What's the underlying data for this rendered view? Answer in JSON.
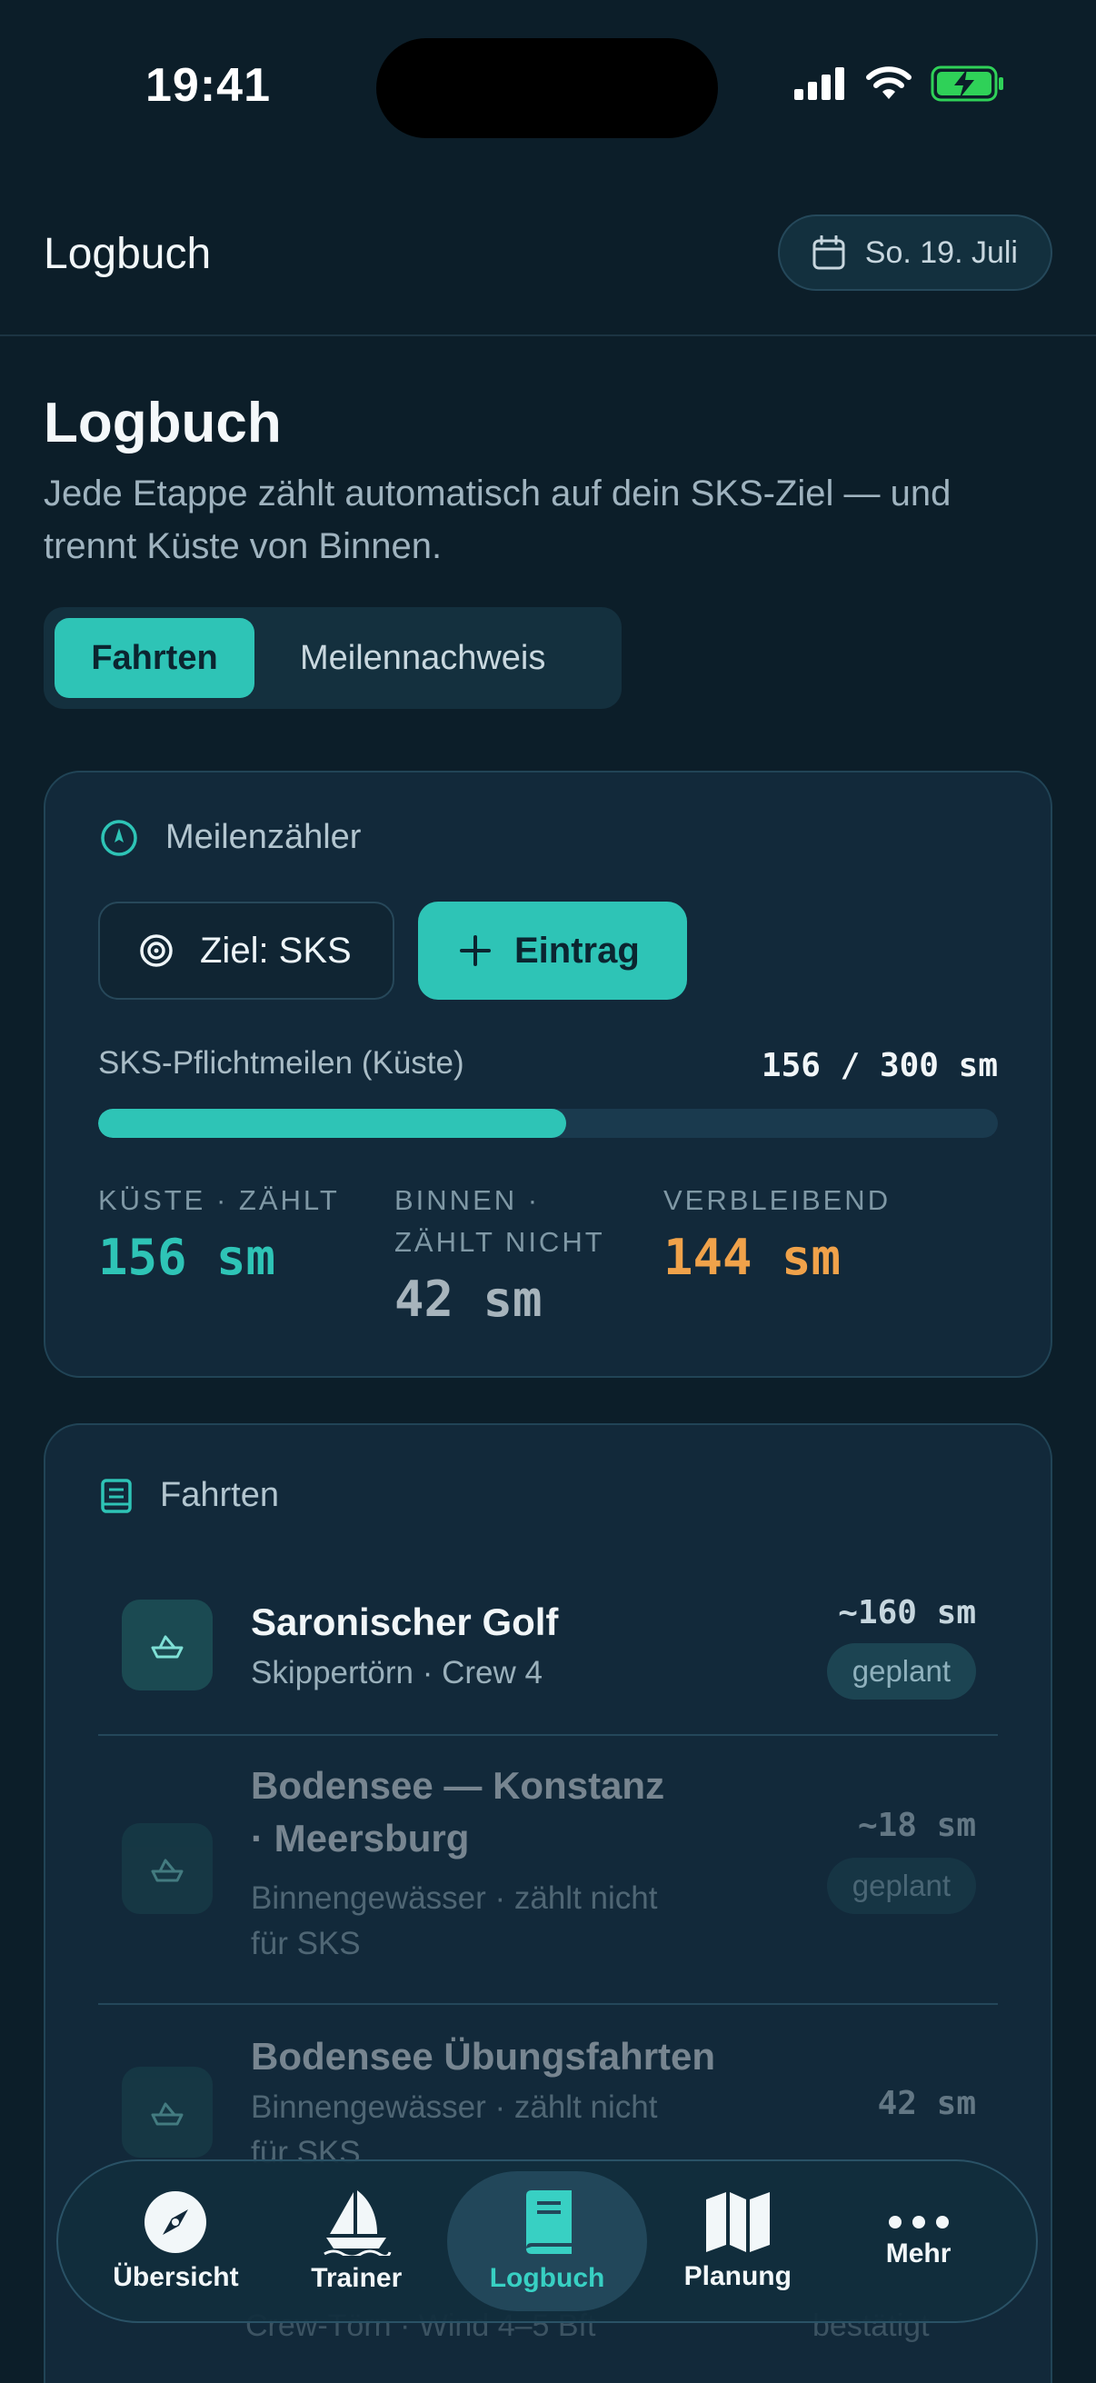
{
  "status": {
    "time": "19:41"
  },
  "header": {
    "title": "Logbuch",
    "date": "So. 19. Juli"
  },
  "page": {
    "title": "Logbuch",
    "subtitle": "Jede Etappe zählt automatisch auf dein SKS-Ziel — und trennt Küste von Binnen."
  },
  "segments": [
    {
      "label": "Fahrten",
      "active": true
    },
    {
      "label": "Meilennachweis",
      "active": false
    }
  ],
  "counter": {
    "heading": "Meilenzähler",
    "goal_label": "Ziel: SKS",
    "add_label": "Eintrag",
    "progress_label": "SKS-Pflichtmeilen (Küste)",
    "progress_value": "156 / 300 sm",
    "progress_fraction": 0.52,
    "stats": [
      {
        "label_line1": "KÜSTE · ZÄHLT",
        "label_line2": "",
        "value": "156 sm",
        "color": "#2ec4b6"
      },
      {
        "label_line1": "BINNEN ·",
        "label_line2": "ZÄHLT NICHT",
        "value": "42 sm",
        "color": "#a7b4bc"
      },
      {
        "label_line1": "VERBLEIBEND",
        "label_line2": "",
        "value": "144 sm",
        "color": "#f0a24a"
      }
    ]
  },
  "trips": {
    "heading": "Fahrten",
    "items": [
      {
        "title": "Saronischer Golf",
        "subtitle": "Skippertörn · Crew 4",
        "miles": "~160 sm",
        "badge": "geplant"
      },
      {
        "title": "Bodensee — Konstanz · Meersburg",
        "subtitle": "Binnengewässer · zählt nicht für SKS",
        "miles": "~18 sm",
        "badge": "geplant"
      },
      {
        "title": "Bodensee Übungsfahrten",
        "subtitle": "Binnengewässer · zählt nicht für SKS",
        "miles": "42 sm",
        "badge": ""
      }
    ],
    "ghost_subtitle": "Crew-Törn · Wind 4–5 Bft",
    "ghost_badge": "bestätigt"
  },
  "tabs": [
    {
      "label": "Übersicht",
      "icon": "compass-icon",
      "active": false
    },
    {
      "label": "Trainer",
      "icon": "sailboat-icon",
      "active": false
    },
    {
      "label": "Logbuch",
      "icon": "book-icon",
      "active": true
    },
    {
      "label": "Planung",
      "icon": "map-icon",
      "active": false
    },
    {
      "label": "Mehr",
      "icon": "more-icon",
      "active": false
    }
  ]
}
